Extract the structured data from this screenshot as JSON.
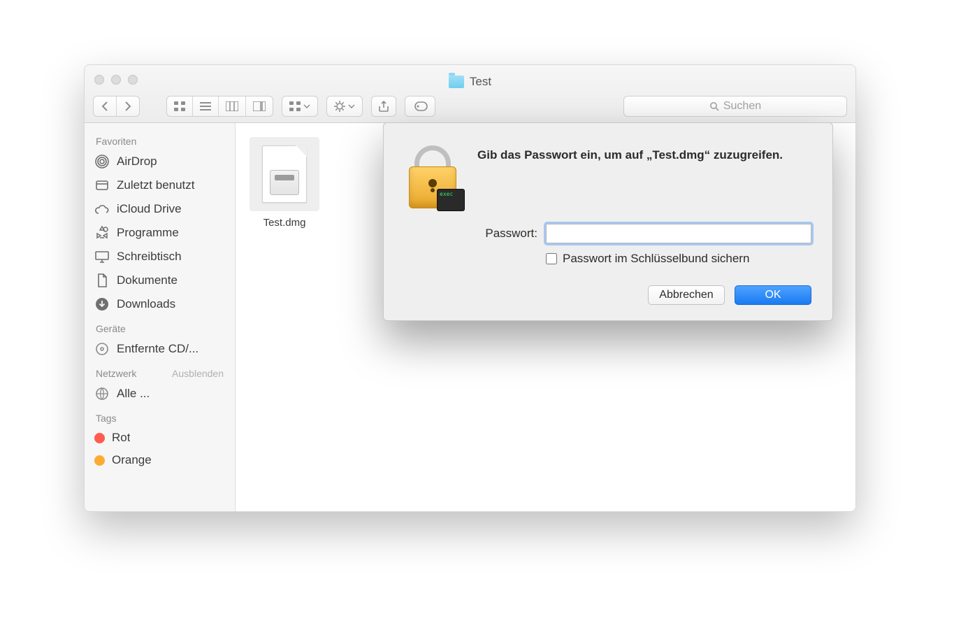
{
  "window": {
    "title": "Test",
    "search_placeholder": "Suchen"
  },
  "sidebar": {
    "sections": {
      "favorites": {
        "heading": "Favoriten"
      },
      "devices": {
        "heading": "Geräte"
      },
      "network": {
        "heading": "Netzwerk",
        "hide_label": "Ausblenden"
      },
      "tags": {
        "heading": "Tags"
      }
    },
    "favorites": [
      {
        "label": "AirDrop"
      },
      {
        "label": "Zuletzt benutzt"
      },
      {
        "label": "iCloud Drive"
      },
      {
        "label": "Programme"
      },
      {
        "label": "Schreibtisch"
      },
      {
        "label": "Dokumente"
      },
      {
        "label": "Downloads"
      }
    ],
    "devices": [
      {
        "label": "Entfernte CD/..."
      }
    ],
    "network": [
      {
        "label": "Alle ..."
      }
    ],
    "tags": [
      {
        "label": "Rot",
        "color": "#ff5b4f"
      },
      {
        "label": "Orange",
        "color": "#ffaa33"
      }
    ]
  },
  "files": [
    {
      "name": "Test.dmg"
    }
  ],
  "dialog": {
    "message": "Gib das Passwort ein, um auf „Test.dmg“ zuzugreifen.",
    "password_label": "Passwort:",
    "password_value": "",
    "keychain_label": "Passwort im Schlüsselbund sichern",
    "cancel": "Abbrechen",
    "ok": "OK",
    "badge_text": "exec"
  }
}
